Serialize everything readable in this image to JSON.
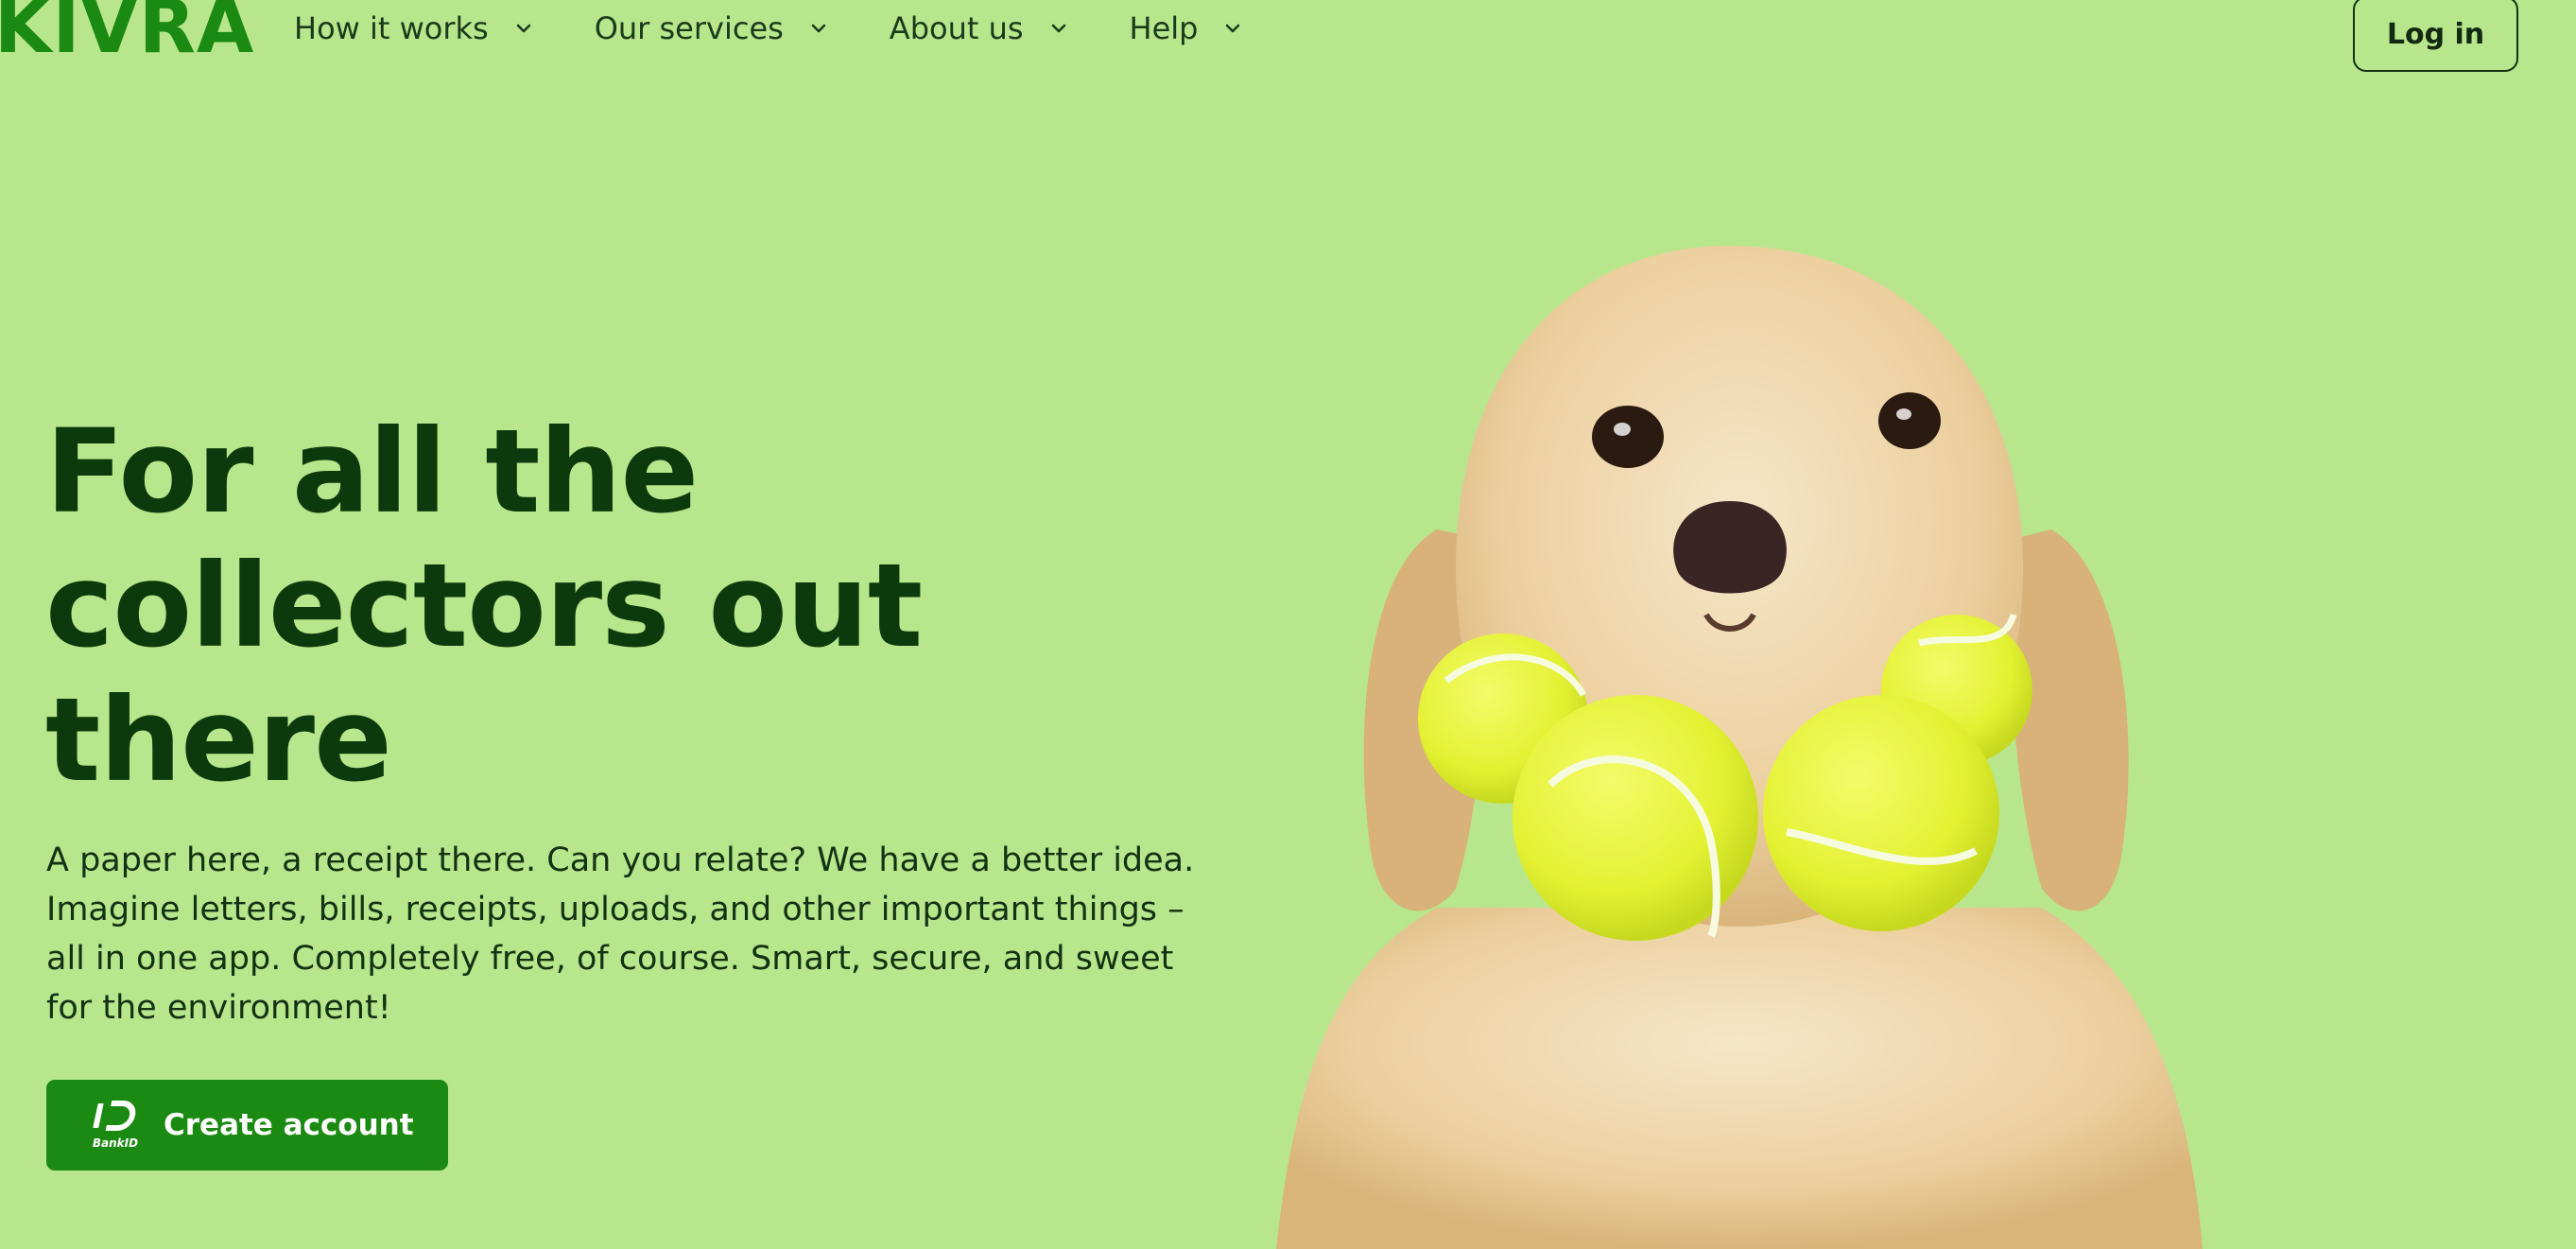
{
  "header": {
    "logo_text": "KIVRA",
    "nav": [
      {
        "label": "How it works"
      },
      {
        "label": "Our services"
      },
      {
        "label": "About us"
      },
      {
        "label": "Help"
      }
    ],
    "login_label": "Log in"
  },
  "hero": {
    "title": "For all the collectors out there",
    "description": "A paper here, a receipt there. Can you relate? We have a better idea. Imagine letters, bills, receipts, uploads, and other important things – all in one app. Completely free, of course. Smart, secure, and sweet for the environment!",
    "cta_label": "Create account",
    "cta_icon": "bankid-icon",
    "cta_icon_text": "BankID",
    "image": "golden-retriever-with-tennis-balls"
  },
  "colors": {
    "background": "#b8e68c",
    "brand_green": "#1b8a12",
    "heading_text": "#0c3a0c",
    "tennis_ball": "#e7f53a"
  }
}
